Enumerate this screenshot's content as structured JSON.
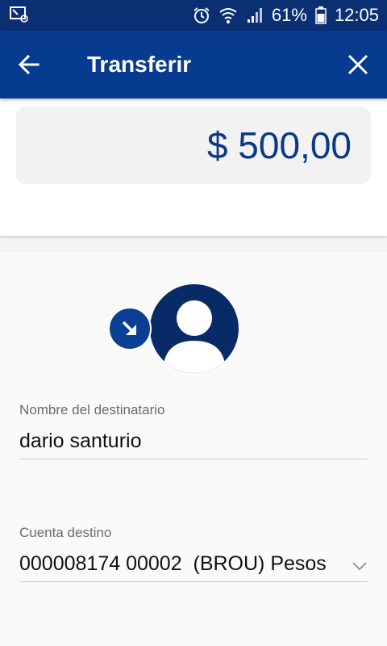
{
  "status_bar": {
    "battery_percent": "61%",
    "time": "12:05"
  },
  "app_bar": {
    "title": "Transferir"
  },
  "amount": {
    "value": "$ 500,00"
  },
  "recipient": {
    "name_label": "Nombre del destinatario",
    "name_value": "dario santurio"
  },
  "destination_account": {
    "label": "Cuenta destino",
    "value": "000008174 00002  (BROU) Pesos"
  },
  "colors": {
    "status_bar_bg": "#0a2f72",
    "app_bar_bg": "#063b8f",
    "amount_text": "#0a3a86",
    "avatar_bg": "#082a66"
  },
  "icons": {
    "back": "arrow-left-icon",
    "close": "close-icon",
    "avatar": "user-avatar-icon",
    "badge": "arrow-down-right-icon",
    "dropdown": "chevron-down-icon"
  }
}
